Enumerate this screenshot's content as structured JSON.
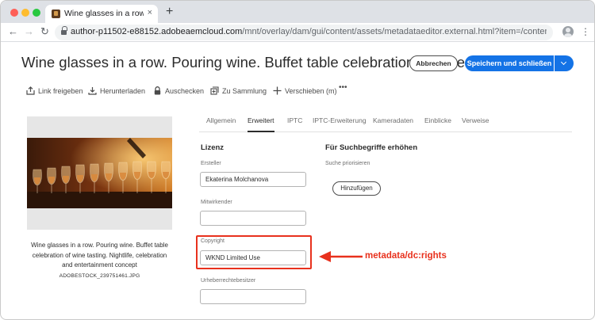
{
  "browser": {
    "tab_title": "Wine glasses in a row. Pouring",
    "tab_close": "×",
    "new_tab": "+",
    "url_host": "author-p11502-e88152.adobeaemcloud.com",
    "url_path": "/mnt/overlay/dam/gui/content/assets/metadataeditor.external.html?item=/content/dam/wknd/en/a..."
  },
  "header": {
    "title": "Wine glasses in a row. Pouring wine. Buffet table celebration of wine tastin",
    "cancel_label": "Abbrechen",
    "save_label": "Speichern und schließen"
  },
  "actions": [
    {
      "label": "Link freigeben",
      "icon": "share-icon"
    },
    {
      "label": "Herunterladen",
      "icon": "download-icon"
    },
    {
      "label": "Auschecken",
      "icon": "lock-icon"
    },
    {
      "label": "Zu Sammlung",
      "icon": "collection-icon"
    },
    {
      "label": "Verschieben (m)",
      "icon": "move-icon"
    },
    {
      "label": "•••",
      "icon": "more-icon"
    }
  ],
  "asset": {
    "description": "Wine glasses in a row. Pouring wine. Buffet table celebration of wine tasting. Nightlife, celebration and entertainment concept",
    "filename": "ADOBESTOCK_239751461.JPG"
  },
  "tabs": [
    {
      "label": "Allgemein",
      "active": false
    },
    {
      "label": "Erweitert",
      "active": true
    },
    {
      "label": "IPTC",
      "active": false
    },
    {
      "label": "IPTC-Erweiterung",
      "active": false
    },
    {
      "label": "Kameradaten",
      "active": false
    },
    {
      "label": "Einblicke",
      "active": false
    },
    {
      "label": "Verweise",
      "active": false
    }
  ],
  "license": {
    "section_title": "Lizenz",
    "creator_label": "Ersteller",
    "creator_value": "Ekaterina Molchanova",
    "contributor_label": "Mitwirkender",
    "contributor_value": "",
    "copyright_label": "Copyright",
    "copyright_value": "WKND Limited Use",
    "owner_label": "Urheberrechtebesitzer",
    "owner_value": ""
  },
  "search": {
    "section_title": "Für Suchbegriffe erhöhen",
    "promote_label": "Suche priorisieren",
    "add_label": "Hinzufügen"
  },
  "annotation": {
    "text": "metadata/dc:rights",
    "color": "#e8311d"
  },
  "colors": {
    "primary": "#1473e6",
    "highlight": "#e8311d"
  }
}
